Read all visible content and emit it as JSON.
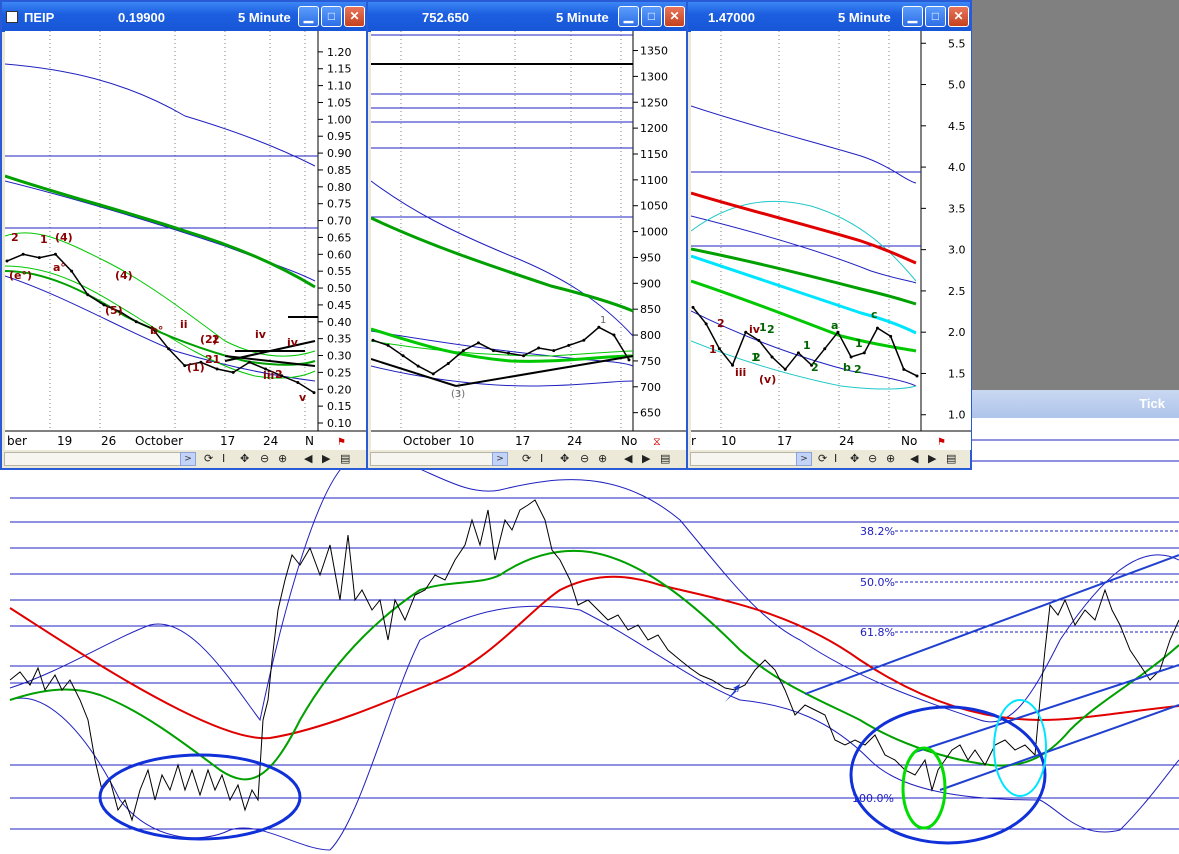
{
  "windows": [
    {
      "symbol": "ΠΕΙΡ",
      "price": "0.19900",
      "timeframe": "5 Minute",
      "y_axis_labels": [
        "1.20",
        "1.15",
        "1.10",
        "1.05",
        "1.00",
        "0.95",
        "0.90",
        "0.85",
        "0.80",
        "0.75",
        "0.70",
        "0.65",
        "0.60",
        "0.55",
        "0.50",
        "0.45",
        "0.40",
        "0.35",
        "0.30",
        "0.25",
        "0.20",
        "0.15",
        "0.10"
      ],
      "x_axis_labels": [
        "ber",
        "19",
        "26",
        "October",
        "17",
        "24",
        "N"
      ],
      "wave_labels": [
        "2",
        "1",
        "(4)",
        "(e°)",
        "a°",
        "(4)",
        "(5)",
        "b°",
        "ii",
        "(2)",
        "2",
        "(1)",
        "21",
        "iv",
        "iv",
        "iii",
        "2",
        "v"
      ]
    },
    {
      "symbol": "",
      "price": "752.650",
      "timeframe": "5 Minute",
      "y_axis_labels": [
        "1350",
        "1300",
        "1250",
        "1200",
        "1150",
        "1100",
        "1050",
        "1000",
        "950",
        "900",
        "850",
        "800",
        "750",
        "700",
        "650"
      ],
      "x_axis_labels": [
        "October",
        "10",
        "17",
        "24",
        "No"
      ],
      "wave_labels": [
        "(3)",
        "1"
      ]
    },
    {
      "symbol": "",
      "price": "1.47000",
      "timeframe": "5 Minute",
      "y_axis_labels": [
        "5.5",
        "5.0",
        "4.5",
        "4.0",
        "3.5",
        "3.0",
        "2.5",
        "2.0",
        "1.5",
        "1.0"
      ],
      "x_axis_labels": [
        "r",
        "10",
        "17",
        "24",
        "No"
      ],
      "wave_labels": [
        "2",
        "1",
        "iv",
        "1",
        "2",
        "1",
        "iii",
        "2",
        "(v)",
        "1",
        "2",
        "a",
        "b",
        "2",
        "1",
        "c"
      ]
    }
  ],
  "main": {
    "title": "Tick",
    "fib_labels": [
      "38.2%",
      "50.0%",
      "61.8%",
      "100.0%"
    ]
  },
  "colors": {
    "price": "#000000",
    "ma_fast": "#00a000",
    "ma_slow": "#e00000",
    "band": "#0000c8",
    "envelope": "#00cc00",
    "cyan": "#00e5ff",
    "highlight_green": "#00dd00",
    "highlight_cyan": "#00e5ff",
    "title_bar": "#1c5fe0"
  },
  "icons": [
    "app-icon",
    "minimize-icon",
    "maximize-icon",
    "close-icon",
    "scroll-left-icon",
    "scroll-right-icon",
    "refresh-icon",
    "cursor-icon",
    "move-icon",
    "zoom-out-icon",
    "zoom-in-icon",
    "prev-icon",
    "next-icon",
    "grid-icon"
  ],
  "chart_data": [
    {
      "type": "line",
      "title": "",
      "xlabel": "",
      "ylabel": "",
      "ylim": [
        0.1,
        1.25
      ],
      "series": [
        {
          "values": [
            0.58,
            0.6,
            0.59,
            0.6,
            0.55,
            0.48,
            0.45,
            0.43,
            0.4,
            0.38,
            0.32,
            0.27,
            0.28,
            0.26,
            0.25,
            0.28,
            0.26,
            0.24,
            0.22,
            0.19
          ]
        }
      ]
    },
    {
      "type": "line",
      "title": "",
      "xlabel": "",
      "ylabel": "",
      "ylim": [
        630,
        1380
      ],
      "series": [
        {
          "values": [
            790,
            780,
            760,
            740,
            725,
            745,
            770,
            785,
            770,
            765,
            760,
            775,
            770,
            780,
            790,
            815,
            800,
            752
          ]
        }
      ]
    },
    {
      "type": "line",
      "title": "",
      "xlabel": "",
      "ylabel": "",
      "ylim": [
        0.9,
        5.6
      ],
      "series": [
        {
          "values": [
            2.3,
            2.1,
            1.8,
            1.6,
            2.0,
            1.9,
            1.7,
            1.55,
            1.75,
            1.6,
            1.8,
            2.0,
            1.7,
            1.75,
            2.05,
            1.95,
            1.55,
            1.47
          ]
        }
      ]
    }
  ]
}
